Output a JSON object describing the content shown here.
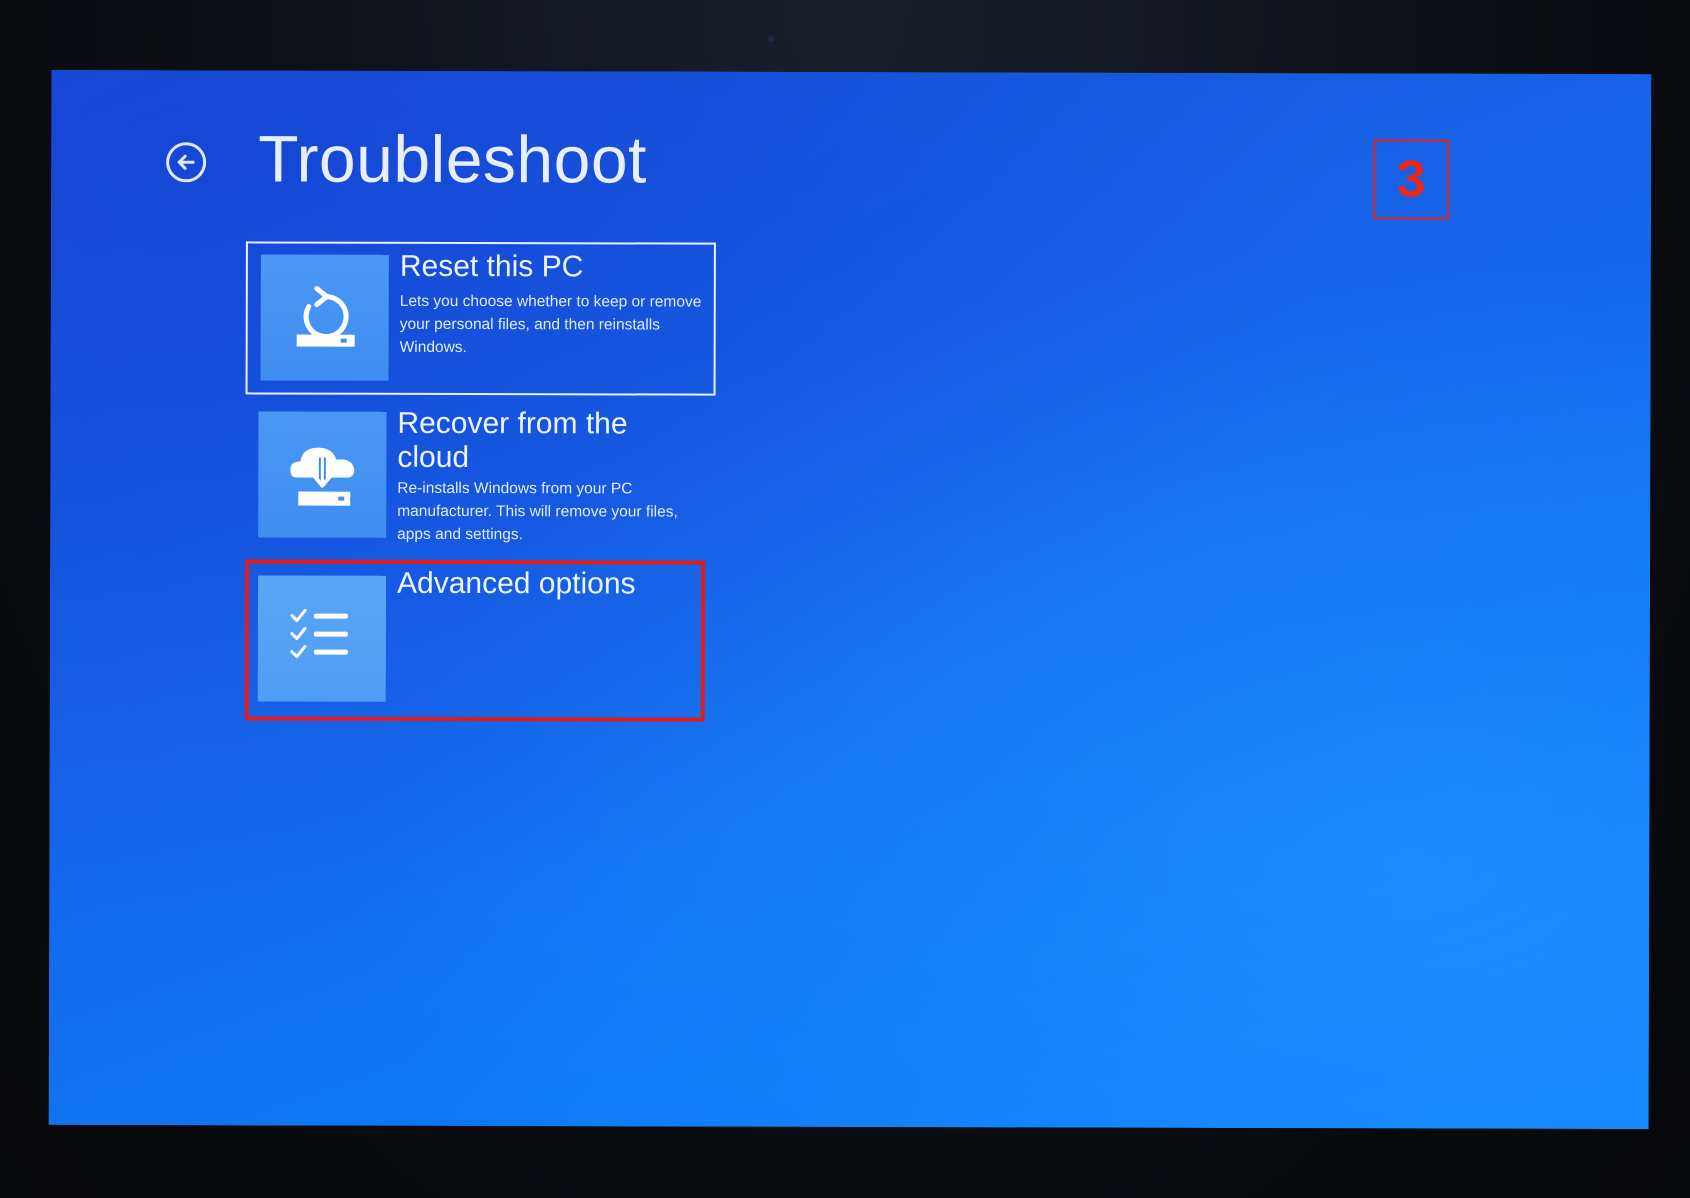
{
  "header": {
    "title": "Troubleshoot",
    "step_number": "3"
  },
  "options": [
    {
      "id": "reset",
      "title": "Reset this PC",
      "description": "Lets you choose whether to keep or remove your personal files, and then reinstalls Windows.",
      "icon": "reset-pc-icon",
      "selected": true
    },
    {
      "id": "cloud",
      "title": "Recover from the cloud",
      "description": "Re-installs Windows from your PC manufacturer. This will remove your files, apps and settings.",
      "icon": "cloud-download-icon",
      "selected": false
    },
    {
      "id": "advanced",
      "title": "Advanced options",
      "description": "",
      "icon": "checklist-icon",
      "highlighted": true
    }
  ],
  "colors": {
    "screen_blue": "#1566ea",
    "tile_blue": "#3e8df0",
    "text_white": "#eef4ff",
    "highlight_red": "#e21b1b"
  }
}
